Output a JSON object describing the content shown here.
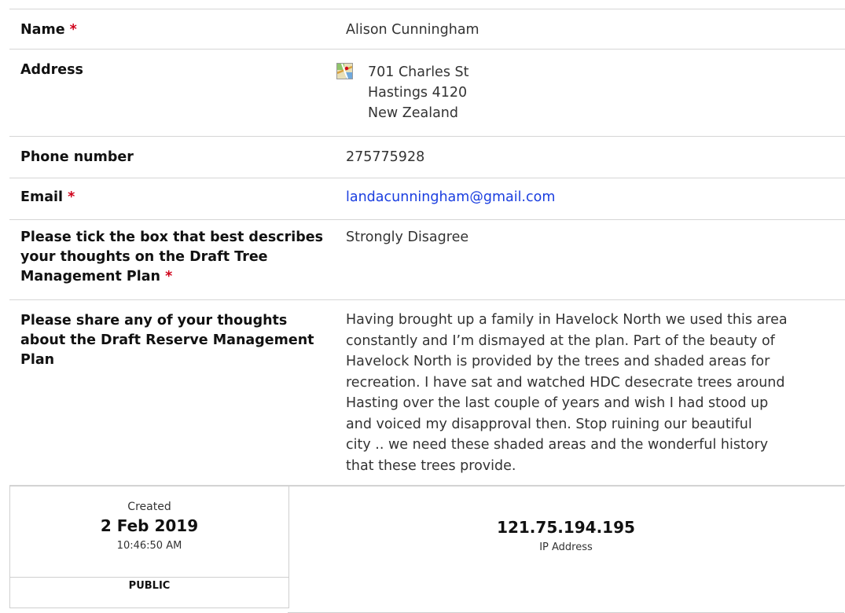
{
  "fields": {
    "name": {
      "label": "Name",
      "required_mark": "*",
      "value": "Alison  Cunningham"
    },
    "address": {
      "label": "Address",
      "icon": "map-icon",
      "line1": "701 Charles St",
      "line2": "Hastings 4120",
      "line3": "New Zealand"
    },
    "phone": {
      "label": "Phone number",
      "value": "275775928"
    },
    "email": {
      "label": "Email",
      "required_mark": "*",
      "value": "landacunningham@gmail.com",
      "color": "#1a3ee0"
    },
    "tick": {
      "label_line1": "Please tick the box that best describes",
      "label_line2": "your thoughts on the Draft Tree",
      "label_line3": "Management Plan",
      "required_mark": "*",
      "value": "Strongly Disagree"
    },
    "thoughts": {
      "label_line1": "Please share any of your thoughts",
      "label_line2": "about the Draft Reserve Management",
      "label_line3": "Plan",
      "lines": [
        "Having brought up a family in Havelock North we used this area",
        "constantly and I’m dismayed at the plan. Part of the beauty of",
        "Havelock North is provided by the trees and shaded areas for",
        "recreation. I have sat and watched HDC desecrate trees around",
        "Hasting over the last couple of years and wish I had stood up",
        "and voiced my disapproval then. Stop ruining our beautiful",
        "city .. we need these shaded areas and the wonderful history",
        "that these trees provide."
      ]
    }
  },
  "meta": {
    "created_label": "Created",
    "created_date": "2 Feb 2019",
    "created_time": "10:46:50 AM",
    "visibility": "PUBLIC",
    "ip_value": "121.75.194.195",
    "ip_label": "IP Address"
  },
  "colors": {
    "required": "#d0021b",
    "divider": "#d6d6d6"
  }
}
